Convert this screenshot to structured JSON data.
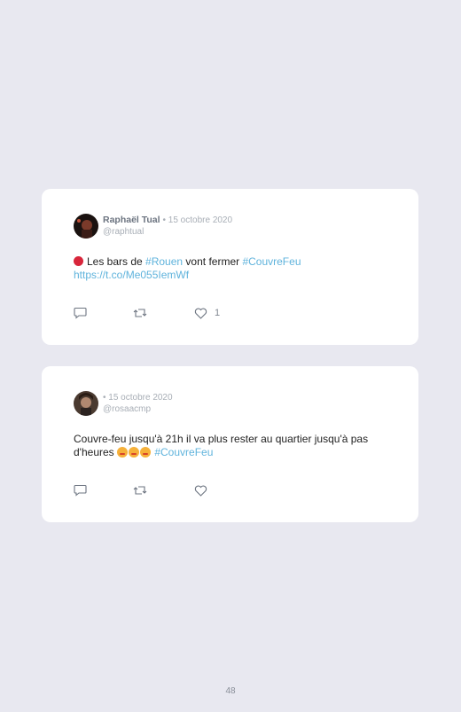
{
  "tweets": [
    {
      "name": "Raphaël Tual",
      "date": "• 15 octobre 2020",
      "handle": "@raphtual",
      "text_before": "Les bars de ",
      "hashtag_1": "#Rouen",
      "text_middle": " vont fermer ",
      "hashtag_2": "#CouvreFeu",
      "link": "https://t.co/Me055IemWf",
      "like_count": "1",
      "icons": [
        "stop-sign-emoji",
        "reply-icon",
        "retweet-icon",
        "heart-icon"
      ]
    },
    {
      "name": "",
      "date": "• 15 octobre 2020",
      "handle": "@rosaacmp",
      "text": "Couvre-feu jusqu'à 21h il va plus rester au quartier jusqu'à pas d'heures ",
      "hashtag": "#CouvreFeu",
      "icons": [
        "party-face-emoji",
        "reply-icon",
        "retweet-icon",
        "heart-icon"
      ]
    }
  ],
  "footer": {
    "page_number": "48"
  },
  "colors": {
    "background": "#e8e8f0",
    "card": "#ffffff",
    "link": "#5fb3dc"
  }
}
